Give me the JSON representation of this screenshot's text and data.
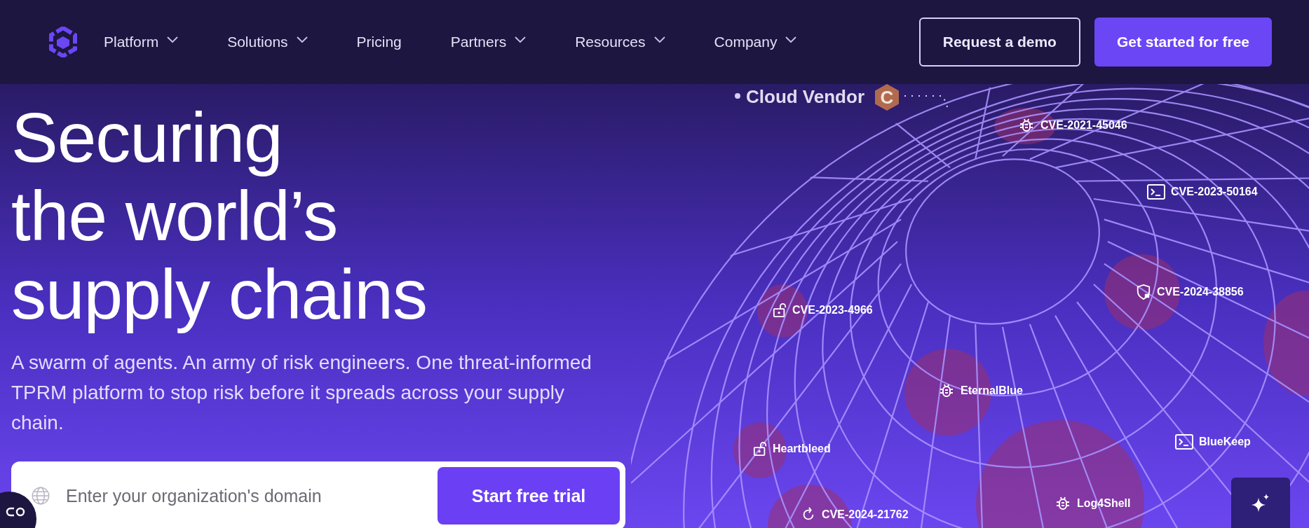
{
  "nav": {
    "items": [
      {
        "label": "Platform",
        "dropdown": true
      },
      {
        "label": "Solutions",
        "dropdown": true
      },
      {
        "label": "Pricing",
        "dropdown": false
      },
      {
        "label": "Partners",
        "dropdown": true
      },
      {
        "label": "Resources",
        "dropdown": true
      },
      {
        "label": "Company",
        "dropdown": true
      }
    ],
    "buttons": [
      {
        "label": "Request a demo",
        "kind": "outline"
      },
      {
        "label": "Get started for free",
        "kind": "solid"
      }
    ]
  },
  "hero": {
    "heading": [
      "Securing",
      "the world’s",
      "supply chains"
    ],
    "subtitle": "A swarm of agents. An army of risk engineers. One threat-informed TPRM platform to stop risk before it spreads across your supply chain.",
    "domain_form": {
      "placeholder": "Enter your organization's domain",
      "button": "Start free trial"
    }
  },
  "graphic": {
    "vendor": {
      "label": "Cloud Vendor",
      "badge": "C"
    },
    "threats": [
      {
        "label": "CVE-2021-45046",
        "kind": "bug"
      },
      {
        "label": "CVE-2023-50164",
        "kind": "terminal"
      },
      {
        "label": "CVE-2024-38856",
        "kind": "shield"
      },
      {
        "label": "CVE-2023-4966",
        "kind": "unlock"
      },
      {
        "label": "EternalBlue",
        "kind": "bug"
      },
      {
        "label": "Heartbleed",
        "kind": "unlock"
      },
      {
        "label": "BlueKeep",
        "kind": "terminal"
      },
      {
        "label": "Log4Shell",
        "kind": "bug"
      },
      {
        "label": "CVE-2024-21762",
        "kind": "refresh"
      }
    ]
  }
}
